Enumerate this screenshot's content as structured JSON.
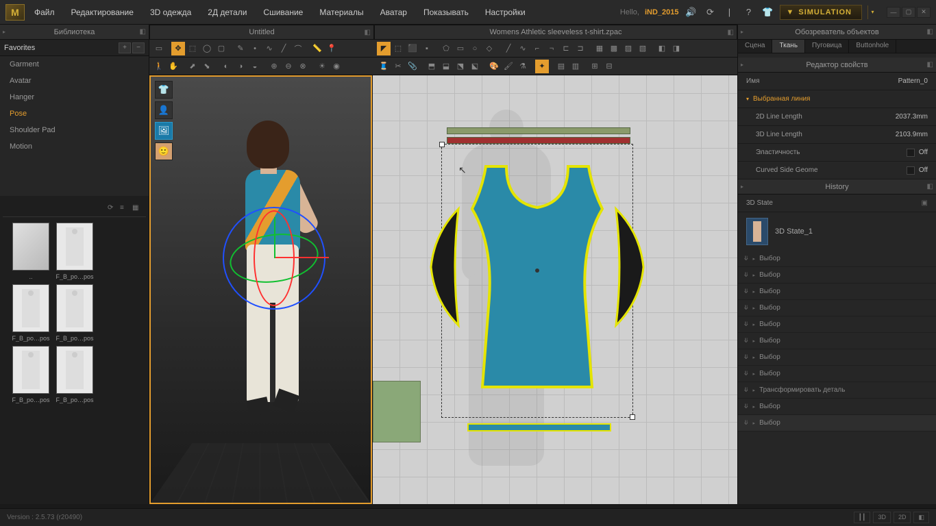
{
  "logo": "M",
  "menu": [
    "Файл",
    "Редактирование",
    "3D одежда",
    "2Д детали",
    "Сшивание",
    "Материалы",
    "Аватар",
    "Показывать",
    "Настройки"
  ],
  "greeting": {
    "hello": "Hello,",
    "user": "iND_2015"
  },
  "simulation_btn": "SIMULATION",
  "library": {
    "title": "Библиотека",
    "favorites": "Favorites",
    "items": [
      "Garment",
      "Avatar",
      "Hanger",
      "Pose",
      "Shoulder Pad",
      "Motion"
    ],
    "active_index": 3,
    "thumbs": [
      "..",
      "F_B_po…pos",
      "F_B_po…pos",
      "F_B_po…pos",
      "F_B_po…pos",
      "F_B_po…pos"
    ]
  },
  "views": {
    "left": "Untitled",
    "right": "Womens Athletic sleeveless t-shirt.zpac"
  },
  "object_browser": {
    "title": "Обозреватель объектов",
    "tabs": [
      "Сцена",
      "Ткань",
      "Пуговица",
      "Buttonhole"
    ],
    "active": 1
  },
  "property_editor": {
    "title": "Редактор свойств",
    "name_key": "Имя",
    "name_val": "Pattern_0",
    "section": "Выбранная линия",
    "rows": [
      {
        "k": "2D Line Length",
        "v": "2037.3mm"
      },
      {
        "k": "3D Line Length",
        "v": "2103.9mm"
      },
      {
        "k": "Эластичность",
        "v": "Off",
        "chk": true
      },
      {
        "k": "Curved Side Geome",
        "v": "Off",
        "chk": true
      }
    ]
  },
  "history": {
    "title": "History",
    "state_section": "3D State",
    "state_name": "3D State_1",
    "items": [
      "Выбор",
      "Выбор",
      "Выбор",
      "Выбор",
      "Выбор",
      "Выбор",
      "Выбор",
      "Выбор",
      "Трансформировать деталь",
      "Выбор",
      "Выбор"
    ]
  },
  "status": {
    "version": "Version : 2.5.73   (r20490)",
    "modes": [
      "3D",
      "2D"
    ]
  }
}
